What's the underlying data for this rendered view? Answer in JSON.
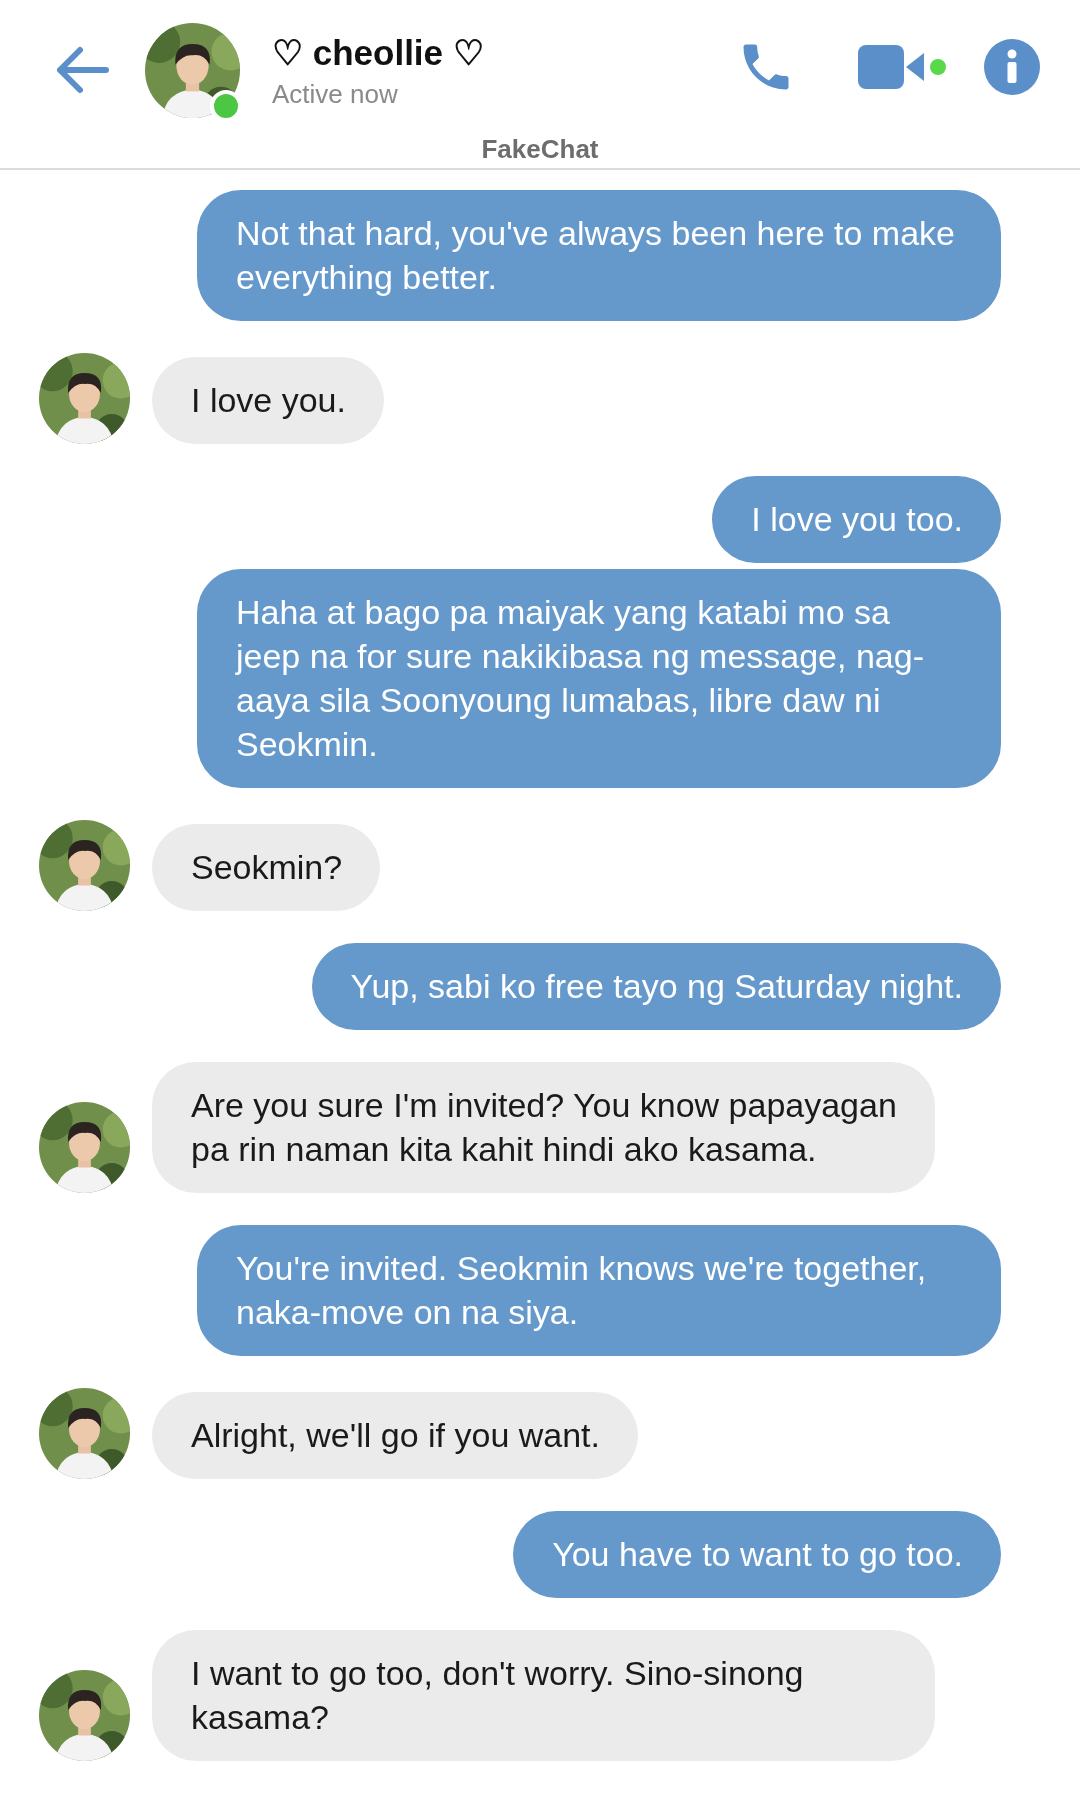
{
  "header": {
    "title": "♡ cheollie ♡",
    "status": "Active now",
    "online": true,
    "app_label": "FakeChat"
  },
  "messages": [
    {
      "kind": "outgoing",
      "text": "Not that hard, you've always been here to make everything better."
    },
    {
      "kind": "incoming",
      "text": "I love you."
    },
    {
      "kind": "outgoing",
      "text": "I love you too."
    },
    {
      "kind": "outgoing",
      "text": "Haha at bago pa maiyak yang katabi mo sa jeep na for sure nakikibasa ng message, nag-aaya sila Soonyoung lumabas, libre daw ni Seokmin."
    },
    {
      "kind": "incoming",
      "text": "Seokmin?"
    },
    {
      "kind": "outgoing",
      "text": "Yup, sabi ko free tayo ng Saturday night."
    },
    {
      "kind": "incoming",
      "text": "Are you sure I'm invited? You know papayagan pa rin naman kita kahit hindi ako kasama."
    },
    {
      "kind": "outgoing",
      "text": "You're invited. Seokmin knows we're together, naka-move on na siya."
    },
    {
      "kind": "incoming",
      "text": "Alright, we'll go if you want."
    },
    {
      "kind": "outgoing",
      "text": "You have to want to go too."
    },
    {
      "kind": "incoming",
      "text": "I want to go too, don't worry. Sino-sinong kasama?"
    }
  ]
}
